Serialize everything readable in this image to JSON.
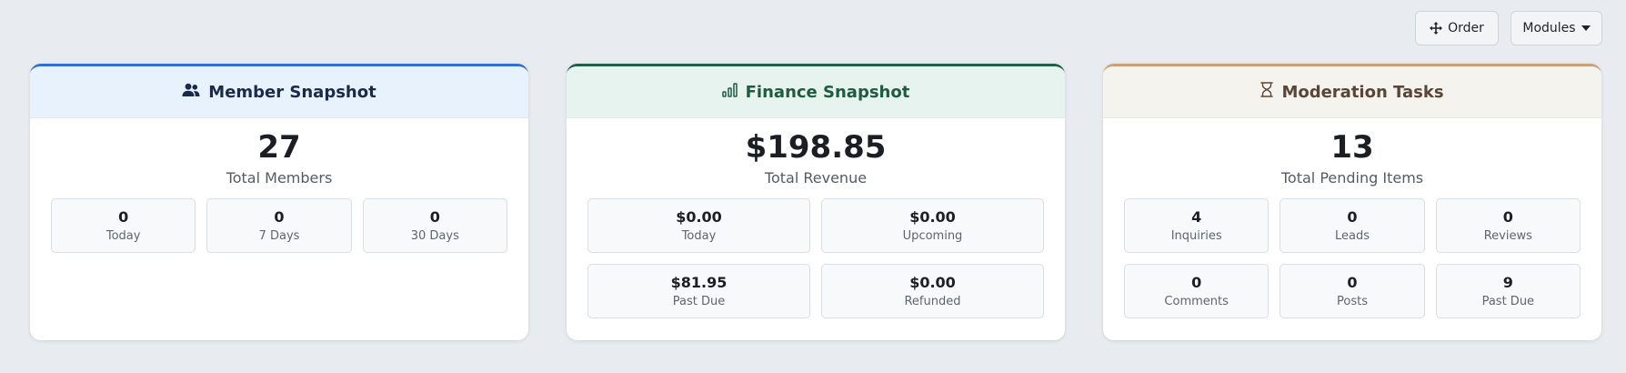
{
  "toolbar": {
    "order_label": "Order",
    "modules_label": "Modules"
  },
  "cards": {
    "member": {
      "title": "Member Snapshot",
      "value": "27",
      "label": "Total Members",
      "stats": [
        {
          "value": "0",
          "label": "Today"
        },
        {
          "value": "0",
          "label": "7 Days"
        },
        {
          "value": "0",
          "label": "30 Days"
        }
      ]
    },
    "finance": {
      "title": "Finance Snapshot",
      "value": "$198.85",
      "label": "Total Revenue",
      "stats": [
        {
          "value": "$0.00",
          "label": "Today"
        },
        {
          "value": "$0.00",
          "label": "Upcoming"
        },
        {
          "value": "$81.95",
          "label": "Past Due"
        },
        {
          "value": "$0.00",
          "label": "Refunded"
        }
      ]
    },
    "moderation": {
      "title": "Moderation Tasks",
      "value": "13",
      "label": "Total Pending Items",
      "stats": [
        {
          "value": "4",
          "label": "Inquiries"
        },
        {
          "value": "0",
          "label": "Leads"
        },
        {
          "value": "0",
          "label": "Reviews"
        },
        {
          "value": "0",
          "label": "Comments"
        },
        {
          "value": "0",
          "label": "Posts"
        },
        {
          "value": "9",
          "label": "Past Due"
        }
      ]
    }
  },
  "colors": {
    "member_accent": "#2f6fd6",
    "finance_accent": "#1f5f45",
    "moderation_accent": "#c9a07a"
  },
  "icons": {
    "order": "move-arrows-icon",
    "modules": "caret-down-icon",
    "member": "users-icon",
    "finance": "bar-chart-icon",
    "moderation": "hourglass-icon"
  }
}
